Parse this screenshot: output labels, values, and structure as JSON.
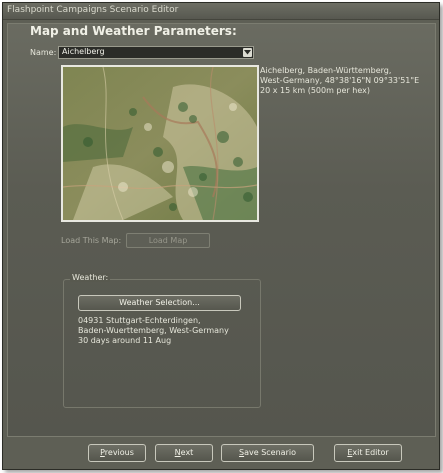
{
  "window": {
    "title": "Flashpoint Campaigns Scenario Editor"
  },
  "heading": "Map and Weather Parameters:",
  "name": {
    "label": "Name:",
    "selected": "Aichelberg"
  },
  "map_info": [
    "Aichelberg, Baden-Württemberg,",
    "West-Germany, 48°38'16\"N 09°33'51\"E",
    "20 x 15 km (500m per hex)"
  ],
  "load": {
    "label": "Load This Map:",
    "button": "Load Map"
  },
  "weather": {
    "title": "Weather:",
    "button": "Weather Selection...",
    "info": [
      "04931 Stuttgart-Echterdingen,",
      "Baden-Wuerttemberg, West-Germany",
      "30 days around 11 Aug"
    ]
  },
  "footer": {
    "previous": {
      "first": "P",
      "rest": "revious"
    },
    "next": {
      "first": "N",
      "rest": "ext"
    },
    "save": {
      "first": "S",
      "rest": "ave Scenario"
    },
    "exit": {
      "first": "E",
      "rest": "xit Editor"
    }
  }
}
